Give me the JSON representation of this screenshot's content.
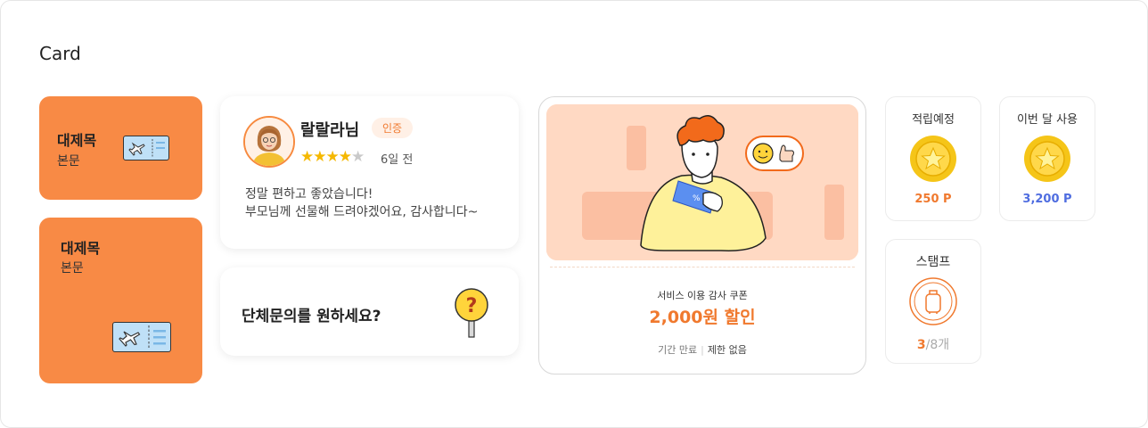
{
  "section_title": "Card",
  "card1": {
    "title": "대제목",
    "body": "본문"
  },
  "card2": {
    "title": "대제목",
    "body": "본문"
  },
  "review": {
    "nickname": "랄랄라님",
    "badge": "인증",
    "rating": 4,
    "rating_max": 5,
    "time_ago": "6일 전",
    "text_line1": "정말 편하고 좋았습니다!",
    "text_line2": "부모님께 선물해 드려야겠어요,  감사합니다~"
  },
  "inquiry": {
    "text": "단체문의를 원하세요?"
  },
  "coupon": {
    "subtitle": "서비스 이용 감사 쿠폰",
    "discount": "2,000원 할인",
    "expiry_label": "기간 만료",
    "expiry_value": "제한 없음"
  },
  "stats": {
    "planned": {
      "label": "적립예정",
      "value": "250 P",
      "color": "#f0792e"
    },
    "monthly": {
      "label": "이번 달 사용",
      "value": "3,200 P",
      "color": "#4f6de0"
    }
  },
  "stamp": {
    "label": "스탬프",
    "current": "3",
    "total": "/8개"
  },
  "colors": {
    "orange": "#f88a45",
    "accent": "#f0792e",
    "blue": "#4f6de0",
    "peach": "#ffd9c3"
  }
}
